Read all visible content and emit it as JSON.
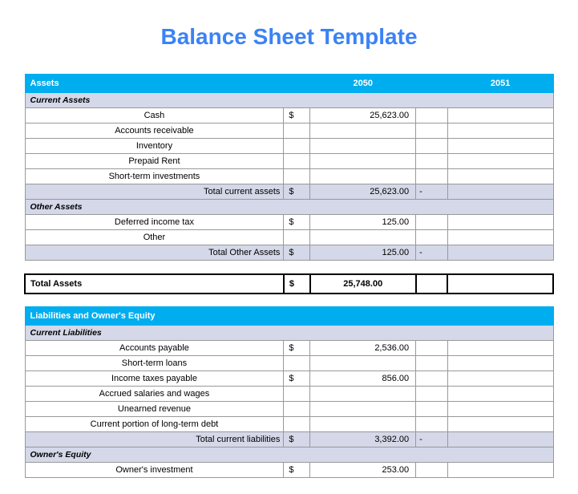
{
  "title": "Balance Sheet Template",
  "years": {
    "y1": "2050",
    "y2": "2051"
  },
  "currency": "$",
  "dash": "-",
  "sections": {
    "assets": {
      "header": "Assets",
      "current": {
        "label": "Current Assets",
        "rows": [
          {
            "label": "Cash",
            "sym": "$",
            "val": "25,623.00"
          },
          {
            "label": "Accounts receivable"
          },
          {
            "label": "Inventory"
          },
          {
            "label": "Prepaid Rent"
          },
          {
            "label": "Short-term investments"
          }
        ],
        "total": {
          "label": "Total current assets",
          "sym": "$",
          "val": "25,623.00",
          "dash2": "-"
        }
      },
      "other": {
        "label": "Other Assets",
        "rows": [
          {
            "label": "Deferred income tax",
            "sym": "$",
            "val": "125.00"
          },
          {
            "label": "Other"
          }
        ],
        "total": {
          "label": "Total Other Assets",
          "sym": "$",
          "val": "125.00",
          "dash2": "-"
        }
      },
      "grand_total": {
        "label": "Total Assets",
        "sym": "$",
        "val": "25,748.00"
      }
    },
    "liab": {
      "header": "Liabilities and Owner's Equity",
      "current": {
        "label": "Current Liabilities",
        "rows": [
          {
            "label": "Accounts payable",
            "sym": "$",
            "val": "2,536.00"
          },
          {
            "label": "Short-term loans"
          },
          {
            "label": "Income taxes payable",
            "sym": "$",
            "val": "856.00"
          },
          {
            "label": "Accrued salaries and wages"
          },
          {
            "label": "Unearned revenue"
          },
          {
            "label": "Current portion of long-term debt"
          }
        ],
        "total": {
          "label": "Total current liabilities",
          "sym": "$",
          "val": "3,392.00",
          "dash2": "-"
        }
      },
      "equity": {
        "label": "Owner's Equity",
        "rows": [
          {
            "label": "Owner's investment",
            "sym": "$",
            "val": "253.00"
          }
        ]
      }
    }
  }
}
